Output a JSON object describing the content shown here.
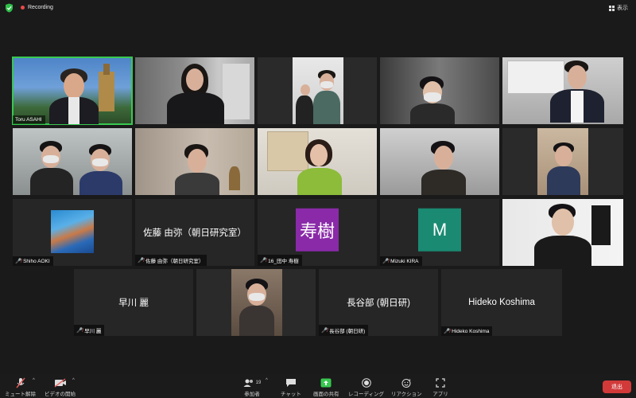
{
  "top": {
    "recording_label": "Recording",
    "view_label": "表示"
  },
  "participants": [
    {
      "id": "t1",
      "name": "Toru ASAHI",
      "muted": false,
      "video": true,
      "active": true
    },
    {
      "id": "t2",
      "name": "",
      "muted": false,
      "video": true
    },
    {
      "id": "t3",
      "name": "",
      "muted": false,
      "video": true
    },
    {
      "id": "t4",
      "name": "",
      "muted": false,
      "video": true
    },
    {
      "id": "t5",
      "name": "",
      "muted": false,
      "video": true
    },
    {
      "id": "t6",
      "name": "",
      "muted": false,
      "video": true
    },
    {
      "id": "t7",
      "name": "",
      "muted": false,
      "video": true
    },
    {
      "id": "t8",
      "name": "",
      "muted": false,
      "video": true
    },
    {
      "id": "t9",
      "name": "",
      "muted": false,
      "video": true
    },
    {
      "id": "t10",
      "name": "",
      "muted": false,
      "video": true
    },
    {
      "id": "t11",
      "name": "Shiho AOKI",
      "muted": true,
      "video": false
    },
    {
      "id": "t12",
      "name": "佐藤 由弥（朝日研究室）",
      "display": "佐藤 由弥（朝日研究室）",
      "muted": true,
      "video": false
    },
    {
      "id": "t13",
      "name": "16_田中 寿樹",
      "avatar_text": "寿樹",
      "avatar_color": "#8a2aa8",
      "muted": true,
      "video": false
    },
    {
      "id": "t14",
      "name": "Mizuki KIRA",
      "avatar_text": "M",
      "avatar_color": "#1a8a72",
      "muted": true,
      "video": false
    },
    {
      "id": "t15",
      "name": "",
      "muted": false,
      "video": true
    },
    {
      "id": "t16",
      "name": "早川 麗",
      "display": "早川 麗",
      "muted": true,
      "video": false
    },
    {
      "id": "t17",
      "name": "",
      "muted": false,
      "video": true
    },
    {
      "id": "t18",
      "name": "長谷部 (朝日研)",
      "display": "長谷部 (朝日研)",
      "muted": true,
      "video": false
    },
    {
      "id": "t19",
      "name": "Hideko Koshima",
      "display": "Hideko Koshima",
      "muted": true,
      "video": false
    }
  ],
  "toolbar": {
    "mute_label": "ミュート解除",
    "video_label": "ビデオの開始",
    "participants_label": "参加者",
    "participants_count": "19",
    "chat_label": "チャット",
    "share_label": "画面の共有",
    "record_label": "レコーディング",
    "reactions_label": "リアクション",
    "apps_label": "アプリ",
    "leave_label": "退出"
  },
  "colors": {
    "active_border": "#38c850",
    "share_green": "#38c850",
    "leave_red": "#d23a3a",
    "recording_red": "#e84a4a"
  }
}
